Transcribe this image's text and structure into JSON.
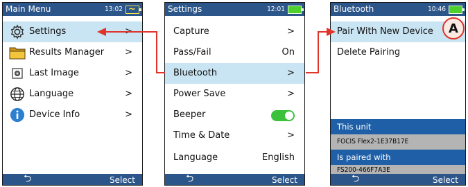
{
  "screens": [
    {
      "title": "Main Menu",
      "time": "13:02",
      "items": [
        {
          "label": "Settings",
          "icon": "gear-icon",
          "chevron": ">"
        },
        {
          "label": "Results Manager",
          "icon": "folder-icon",
          "chevron": ">"
        },
        {
          "label": "Last Image",
          "icon": "image-icon",
          "chevron": ">"
        },
        {
          "label": "Language",
          "icon": "globe-icon",
          "chevron": ">"
        },
        {
          "label": "Device Info",
          "icon": "info-icon",
          "chevron": ">"
        }
      ],
      "back": "⮌",
      "select": "Select"
    },
    {
      "title": "Settings",
      "time": "12:01",
      "items": [
        {
          "label": "Capture",
          "value": ">"
        },
        {
          "label": "Pass/Fail",
          "value": "On"
        },
        {
          "label": "Bluetooth",
          "value": ">"
        },
        {
          "label": "Power Save",
          "value": ">"
        },
        {
          "label": "Beeper",
          "value": ""
        },
        {
          "label": "Time & Date",
          "value": ">"
        },
        {
          "label": "Language",
          "value": "English"
        }
      ],
      "back": "⮌",
      "select": "Select"
    },
    {
      "title": "Bluetooth",
      "time": "10:46",
      "items": [
        {
          "label": "Pair With New Device"
        },
        {
          "label": "Delete Pairing"
        }
      ],
      "this_unit_label": "This unit",
      "this_unit_value": "FOCIS Flex2-1E37B17E",
      "paired_label": "Is paired with",
      "paired_value": "FS200-466F7A3E",
      "back": "⮌",
      "select": "Select"
    }
  ],
  "callout": "A",
  "colors": {
    "titlebar": "#2c5589",
    "highlight": "#c9e4f2",
    "arrow": "#e0332a",
    "toggle": "#3cc13c"
  }
}
